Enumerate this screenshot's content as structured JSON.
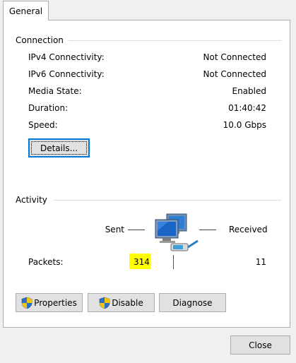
{
  "tabs": [
    {
      "label": "General"
    }
  ],
  "connection": {
    "heading": "Connection",
    "rows": [
      {
        "label": "IPv4 Connectivity:",
        "value": "Not Connected"
      },
      {
        "label": "IPv6 Connectivity:",
        "value": "Not Connected"
      },
      {
        "label": "Media State:",
        "value": "Enabled"
      },
      {
        "label": "Duration:",
        "value": "01:40:42"
      },
      {
        "label": "Speed:",
        "value": "10.0 Gbps"
      }
    ],
    "details_button": "Details..."
  },
  "activity": {
    "heading": "Activity",
    "sent_label": "Sent",
    "received_label": "Received",
    "packets_label": "Packets:",
    "packets_sent": "314",
    "packets_received": "11",
    "icon": "network-computers-icon",
    "highlight_color": "#ffff00"
  },
  "buttons": {
    "properties": "Properties",
    "disable": "Disable",
    "diagnose": "Diagnose",
    "close": "Close"
  },
  "colors": {
    "focus_border": "#0078d7",
    "shield_blue": "#2e6fc6",
    "shield_yellow": "#f3c510"
  }
}
